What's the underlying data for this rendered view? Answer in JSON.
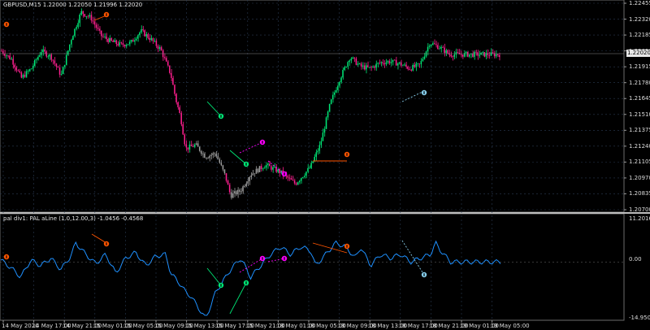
{
  "main_title": "GBPUSD,M15  1.22000 1.22050 1.21996 1.22020",
  "indicator_title": "pal div1:  PAL aLine (1.0,12.00,3) -1.0456 -0.4568",
  "current_price": "1.22020",
  "price_axis": [
    "1.22455",
    "1.22320",
    "1.22185",
    "1.22050",
    "1.21915",
    "1.21780",
    "1.21645",
    "1.21510",
    "1.21375",
    "1.21240",
    "1.21105",
    "1.20970",
    "1.20835",
    "1.20700"
  ],
  "indicator_axis": {
    "top": "11.2016",
    "zero": "0.00",
    "bottom": "-14.9504"
  },
  "time_axis": [
    "14 May 2020",
    "14 May 17:00",
    "14 May 21:00",
    "15 May 01:00",
    "15 May 05:00",
    "15 May 09:00",
    "15 May 13:00",
    "15 May 17:00",
    "15 May 21:00",
    "18 May 01:00",
    "18 May 05:00",
    "18 May 09:00",
    "18 May 13:00",
    "18 May 17:00",
    "18 May 21:00",
    "19 May 01:00",
    "19 May 05:00"
  ],
  "colors": {
    "background": "#000000",
    "grid": "#2a3a52",
    "bull": "#00e676",
    "bear": "#ff1f8f",
    "neutral": "#9e9e9e",
    "indicator": "#1e90ff",
    "div_bear": "#ff5500",
    "div_bull": "#00e676",
    "div_hidden": "#ff00ff",
    "div_cyan": "#87ceeb"
  },
  "chart_data": {
    "type": "candlestick",
    "symbol": "GBPUSD",
    "timeframe": "M15",
    "y_range": [
      1.207,
      1.22455
    ],
    "price_path": [
      [
        0,
        1.2205
      ],
      [
        0.02,
        1.2198
      ],
      [
        0.04,
        1.2182
      ],
      [
        0.06,
        1.219
      ],
      [
        0.08,
        1.2205
      ],
      [
        0.1,
        1.22
      ],
      [
        0.12,
        1.2184
      ],
      [
        0.14,
        1.2215
      ],
      [
        0.16,
        1.2238
      ],
      [
        0.18,
        1.2233
      ],
      [
        0.2,
        1.2218
      ],
      [
        0.22,
        1.2213
      ],
      [
        0.24,
        1.221
      ],
      [
        0.26,
        1.2212
      ],
      [
        0.28,
        1.2222
      ],
      [
        0.3,
        1.2215
      ],
      [
        0.32,
        1.2206
      ],
      [
        0.34,
        1.2185
      ],
      [
        0.35,
        1.2164
      ],
      [
        0.36,
        1.2148
      ],
      [
        0.37,
        1.2122
      ],
      [
        0.39,
        1.2125
      ],
      [
        0.41,
        1.2115
      ],
      [
        0.43,
        1.2118
      ],
      [
        0.45,
        1.2098
      ],
      [
        0.46,
        1.2082
      ],
      [
        0.48,
        1.2086
      ],
      [
        0.5,
        1.21
      ],
      [
        0.53,
        1.2108
      ],
      [
        0.56,
        1.2102
      ],
      [
        0.59,
        1.2092
      ],
      [
        0.62,
        1.2106
      ],
      [
        0.64,
        1.2125
      ],
      [
        0.66,
        1.216
      ],
      [
        0.68,
        1.2182
      ],
      [
        0.7,
        1.22
      ],
      [
        0.72,
        1.2192
      ],
      [
        0.74,
        1.219
      ],
      [
        0.76,
        1.2195
      ],
      [
        0.78,
        1.2196
      ],
      [
        0.8,
        1.2194
      ],
      [
        0.82,
        1.219
      ],
      [
        0.84,
        1.2193
      ],
      [
        0.86,
        1.2212
      ],
      [
        0.88,
        1.2208
      ],
      [
        0.9,
        1.2202
      ]
    ],
    "indicator_range": [
      -14.9504,
      11.2016
    ],
    "indicator_path": [
      [
        0,
        0.5
      ],
      [
        0.02,
        -1.5
      ],
      [
        0.04,
        -4
      ],
      [
        0.06,
        0.5
      ],
      [
        0.08,
        -1
      ],
      [
        0.1,
        1
      ],
      [
        0.12,
        -2
      ],
      [
        0.14,
        1.5
      ],
      [
        0.15,
        5
      ],
      [
        0.17,
        2
      ],
      [
        0.19,
        -0.5
      ],
      [
        0.21,
        2
      ],
      [
        0.23,
        -3
      ],
      [
        0.25,
        1
      ],
      [
        0.27,
        2.5
      ],
      [
        0.29,
        -1
      ],
      [
        0.31,
        1.5
      ],
      [
        0.33,
        2
      ],
      [
        0.34,
        -3
      ],
      [
        0.36,
        -6
      ],
      [
        0.37,
        -8
      ],
      [
        0.38,
        -9
      ],
      [
        0.4,
        -13
      ],
      [
        0.41,
        -15
      ],
      [
        0.43,
        -8
      ],
      [
        0.45,
        -4
      ],
      [
        0.46,
        -2
      ],
      [
        0.48,
        1
      ],
      [
        0.5,
        -4
      ],
      [
        0.52,
        -1
      ],
      [
        0.54,
        2
      ],
      [
        0.56,
        4
      ],
      [
        0.58,
        2
      ],
      [
        0.6,
        4
      ],
      [
        0.62,
        3
      ],
      [
        0.63,
        -1
      ],
      [
        0.65,
        2
      ],
      [
        0.67,
        5
      ],
      [
        0.69,
        4
      ],
      [
        0.71,
        1
      ],
      [
        0.72,
        4
      ],
      [
        0.74,
        -1
      ],
      [
        0.76,
        2
      ],
      [
        0.78,
        1
      ],
      [
        0.8,
        2
      ],
      [
        0.82,
        0
      ],
      [
        0.84,
        1
      ],
      [
        0.86,
        2
      ],
      [
        0.87,
        5
      ],
      [
        0.88,
        3
      ],
      [
        0.9,
        0
      ]
    ],
    "grid": true
  }
}
